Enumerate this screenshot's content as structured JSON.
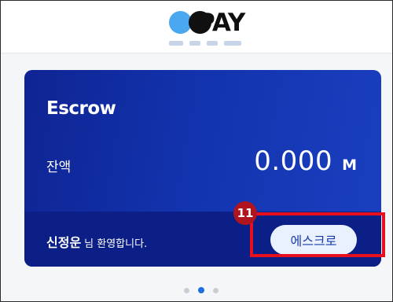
{
  "header": {
    "logo_text": "PAY"
  },
  "card": {
    "title": "Escrow",
    "balance_label": "잔액",
    "balance_value": "0.000",
    "balance_unit": "M",
    "user_name": "신정운",
    "greeting": "님 환영합니다.",
    "escrow_button": "에스크로"
  },
  "annotation": {
    "badge_number": "11",
    "highlight_color": "#e8101f"
  },
  "pager": {
    "count": 3,
    "active_index": 1
  },
  "colors": {
    "card_bg": "#1233ad",
    "card_footer_bg": "#0c1f86",
    "button_bg": "#e9f1ff",
    "accent_blue": "#4aa8f0"
  }
}
